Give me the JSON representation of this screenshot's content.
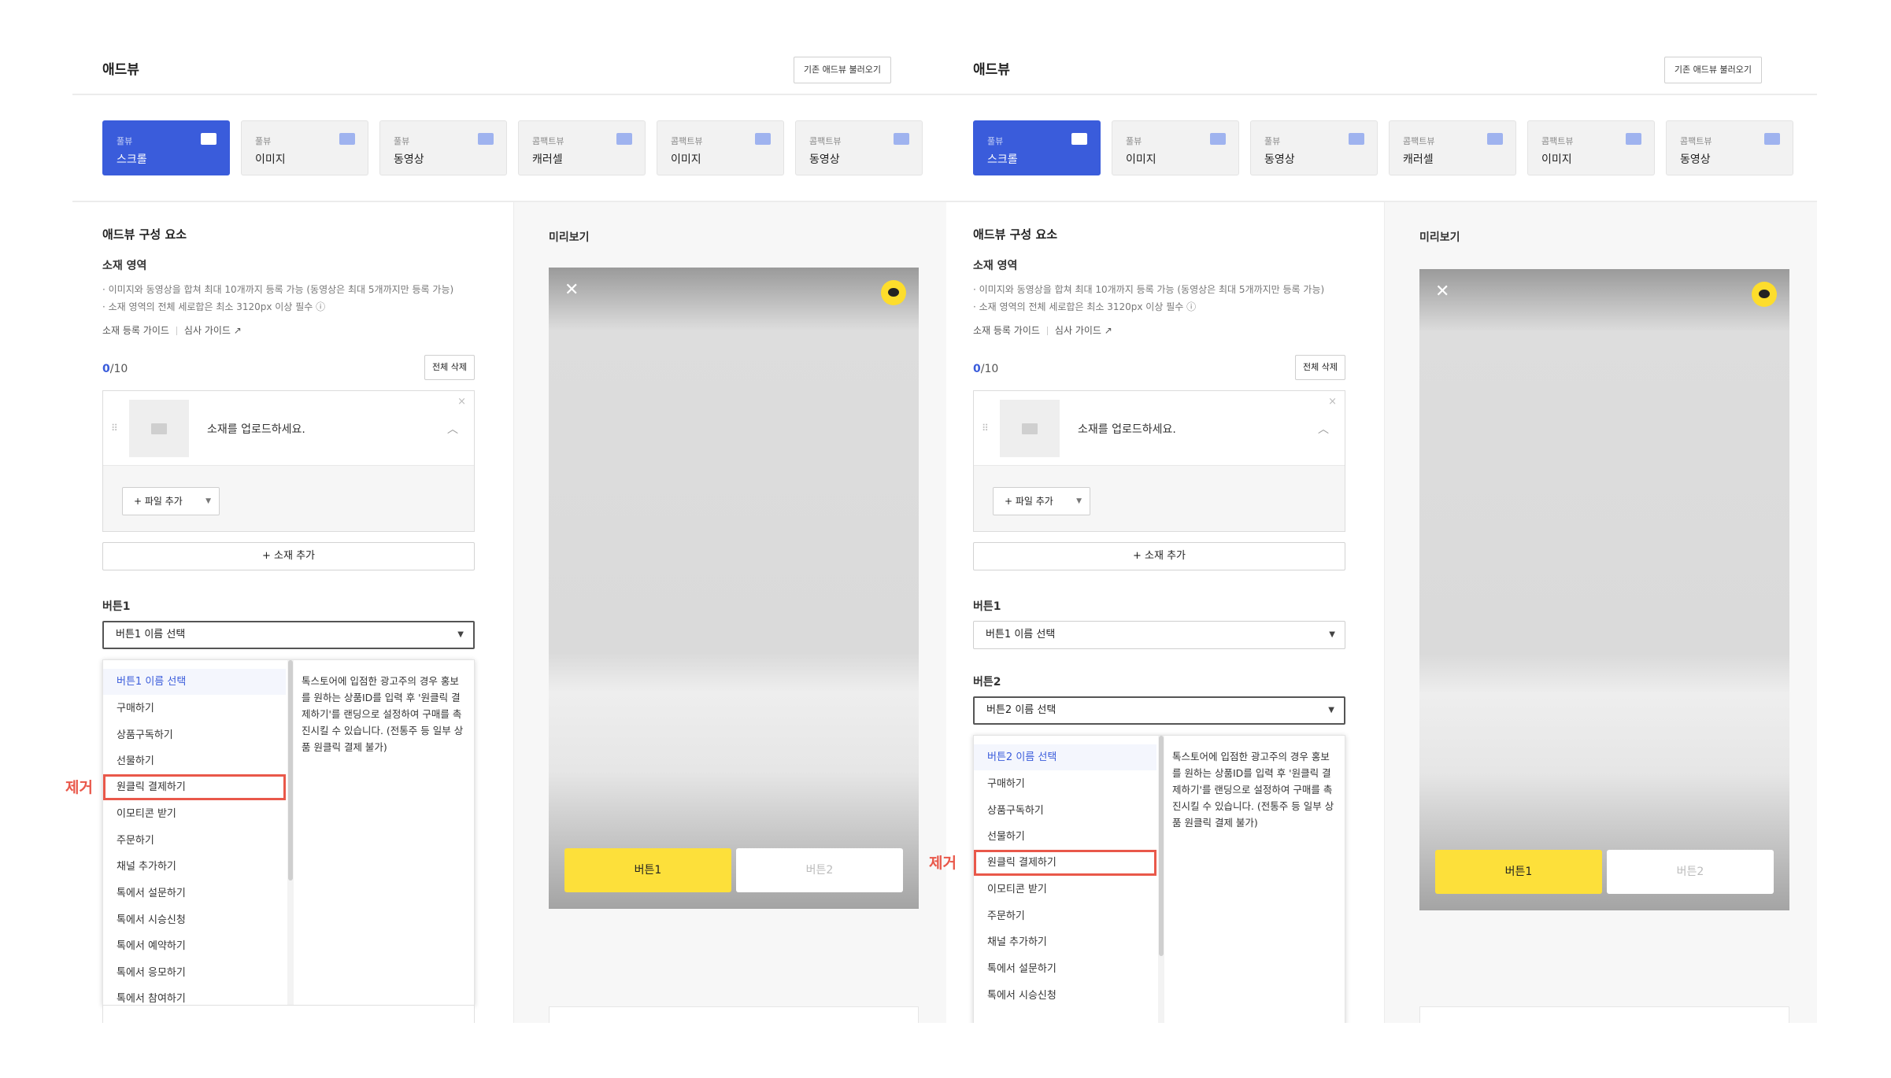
{
  "panels": [
    {
      "header": {
        "title": "애드뷰",
        "load_button": "기존 애드뷰 불러오기"
      },
      "types": [
        {
          "category": "풀뷰",
          "name": "스크롤",
          "icon": "image-icon",
          "active": true
        },
        {
          "category": "풀뷰",
          "name": "이미지",
          "icon": "image-icon",
          "active": false
        },
        {
          "category": "풀뷰",
          "name": "동영상",
          "icon": "video-icon",
          "active": false
        },
        {
          "category": "콤팩트뷰",
          "name": "캐러셀",
          "icon": "image-icon",
          "active": false
        },
        {
          "category": "콤팩트뷰",
          "name": "이미지",
          "icon": "image-icon",
          "active": false
        },
        {
          "category": "콤팩트뷰",
          "name": "동영상",
          "icon": "video-icon",
          "active": false
        }
      ],
      "editor": {
        "section_title": "애드뷰 구성 요소",
        "material_area": "소재 영역",
        "notes": [
          "· 이미지와 동영상을 합쳐 최대 10개까지 등록 가능 (동영상은 최대 5개까지만 등록 가능)",
          "· 소재 영역의 전체 세로합은 최소 3120px 이상 필수 ⓘ"
        ],
        "links": [
          "소재 등록 가이드",
          "심사 가이드 ↗"
        ],
        "counter": {
          "current": "0",
          "max": "/10"
        },
        "delete_all": "전체 삭제",
        "upload_text": "소재를 업로드하세요.",
        "file_add": "+ 파일 추가",
        "add_material": "+ 소재 추가",
        "button1_label": "버튼1",
        "button1_select": "버튼1 이름 선택",
        "dropdown_options": [
          "버튼1 이름 선택",
          "구매하기",
          "상품구독하기",
          "선물하기",
          "원클릭 결제하기",
          "이모티콘 받기",
          "주문하기",
          "채널 추가하기",
          "톡에서 설문하기",
          "톡에서 시승신청",
          "톡에서 예약하기",
          "톡에서 응모하기",
          "톡에서 참여하기"
        ],
        "dropdown_desc": "톡스토어에 입점한 광고주의 경우 홍보를 원하는 상품ID를 입력 후 '원클릭 결제하기'를 랜딩으로 설정하여 구매를 촉진시킬 수 있습니다. (전통주 등 일부 상품 원클릭 결제 불가)",
        "remove_label": "제거"
      },
      "preview": {
        "title": "미리보기",
        "button1": "버튼1",
        "button2": "버튼2"
      }
    },
    {
      "header": {
        "title": "애드뷰",
        "load_button": "기존 애드뷰 불러오기"
      },
      "types": [
        {
          "category": "풀뷰",
          "name": "스크롤",
          "icon": "image-icon",
          "active": true
        },
        {
          "category": "풀뷰",
          "name": "이미지",
          "icon": "image-icon",
          "active": false
        },
        {
          "category": "풀뷰",
          "name": "동영상",
          "icon": "video-icon",
          "active": false
        },
        {
          "category": "콤팩트뷰",
          "name": "캐러셀",
          "icon": "image-icon",
          "active": false
        },
        {
          "category": "콤팩트뷰",
          "name": "이미지",
          "icon": "image-icon",
          "active": false
        },
        {
          "category": "콤팩트뷰",
          "name": "동영상",
          "icon": "video-icon",
          "active": false
        }
      ],
      "editor": {
        "section_title": "애드뷰 구성 요소",
        "material_area": "소재 영역",
        "notes": [
          "· 이미지와 동영상을 합쳐 최대 10개까지 등록 가능 (동영상은 최대 5개까지만 등록 가능)",
          "· 소재 영역의 전체 세로합은 최소 3120px 이상 필수 ⓘ"
        ],
        "links": [
          "소재 등록 가이드",
          "심사 가이드 ↗"
        ],
        "counter": {
          "current": "0",
          "max": "/10"
        },
        "delete_all": "전체 삭제",
        "upload_text": "소재를 업로드하세요.",
        "file_add": "+ 파일 추가",
        "add_material": "+ 소재 추가",
        "button1_label": "버튼1",
        "button1_select": "버튼1 이름 선택",
        "button2_label": "버튼2",
        "button2_select": "버튼2 이름 선택",
        "dropdown_options": [
          "버튼2 이름 선택",
          "구매하기",
          "상품구독하기",
          "선물하기",
          "원클릭 결제하기",
          "이모티콘 받기",
          "주문하기",
          "채널 추가하기",
          "톡에서 설문하기",
          "톡에서 시승신청"
        ],
        "dropdown_desc": "톡스토어에 입점한 광고주의 경우 홍보를 원하는 상품ID를 입력 후 '원클릭 결제하기'를 랜딩으로 설정하여 구매를 촉진시킬 수 있습니다. (전통주 등 일부 상품 원클릭 결제 불가)",
        "remove_label": "제거"
      },
      "preview": {
        "title": "미리보기",
        "button1": "버튼1",
        "button2": "버튼2"
      }
    }
  ],
  "colors": {
    "accent": "#3a5cdb",
    "kakao_yellow": "#fde03a",
    "highlight_red": "#e9584a"
  }
}
